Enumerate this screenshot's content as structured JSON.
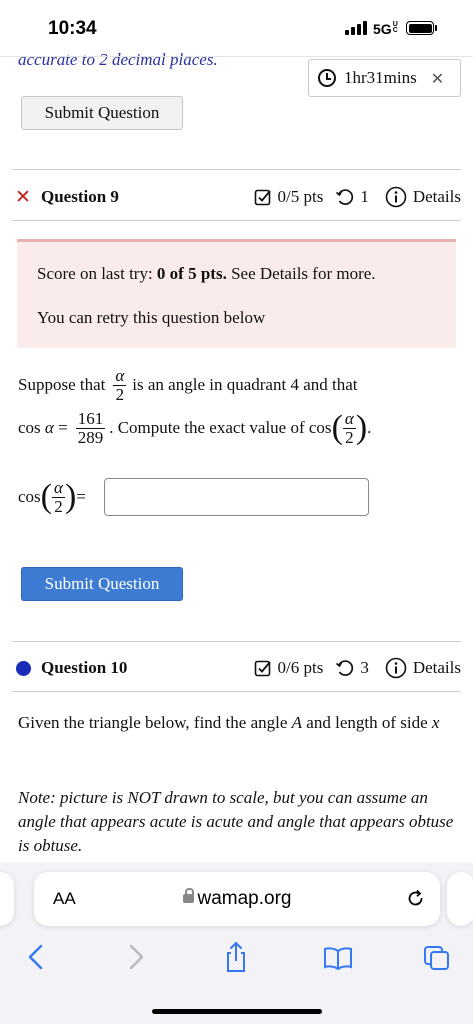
{
  "status_bar": {
    "time": "10:34",
    "network": "5G",
    "network_suffix": "UC"
  },
  "top": {
    "cutoff_text": "accurate to 2 decimal places.",
    "timer": "1hr31mins",
    "submit_label": "Submit Question"
  },
  "question9": {
    "title": "Question 9",
    "points": "0/5 pts",
    "retries": "1",
    "details_label": "Details",
    "score_prefix": "Score on last try: ",
    "score_value": "0 of 5 pts.",
    "score_suffix": " See Details for more.",
    "retry_text": "You can retry this question below",
    "line1_a": "Suppose that",
    "alpha": "α",
    "two": "2",
    "line1_b": "is an angle in quadrant 4 and that",
    "cos": "cos",
    "equals": "=",
    "cos_num": "161",
    "cos_den": "289",
    "line2_b": ". Compute the exact value of",
    "period": ".",
    "answer_value": "",
    "submit_label": "Submit Question"
  },
  "question10": {
    "title": "Question 10",
    "points": "0/6 pts",
    "retries": "3",
    "details_label": "Details",
    "text_a": "Given the triangle below, find the angle ",
    "text_var_a": "A",
    "text_b": " and length of side ",
    "text_var_x": "x",
    "note": "Note: picture is NOT drawn to scale, but you can assume an angle that appears acute is acute and angle that appears obtuse is obtuse."
  },
  "safari": {
    "aa": "AA",
    "domain": "wamap.org"
  },
  "colors": {
    "error_red": "#c0231d",
    "dot_blue": "#1a2bb8",
    "button_blue": "#3e7bd3",
    "score_bg": "#fbecec",
    "ios_blue": "#3478f6"
  },
  "icons": [
    "clock-icon",
    "close-icon",
    "checkbox-icon",
    "retry-icon",
    "info-icon",
    "lock-icon",
    "reload-icon",
    "back-icon",
    "forward-icon",
    "share-icon",
    "bookmarks-icon",
    "tabs-icon"
  ]
}
